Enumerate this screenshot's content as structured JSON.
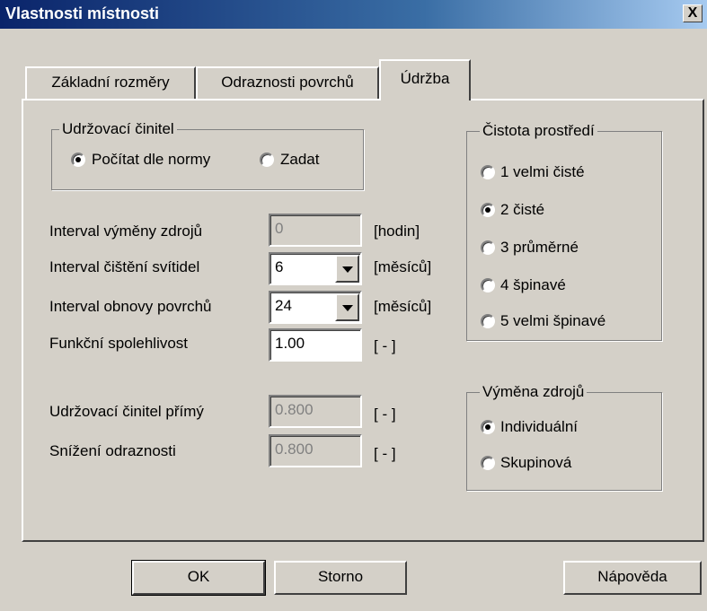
{
  "window": {
    "title": "Vlastnosti místnosti",
    "close_label": "X"
  },
  "tabs": [
    {
      "label": "Základní rozměry"
    },
    {
      "label": "Odraznosti povrchů"
    },
    {
      "label": "Údržba",
      "active": true
    }
  ],
  "udrzovaci_group": {
    "legend": "Udržovací činitel",
    "options": [
      {
        "label": "Počítat dle normy",
        "checked": true
      },
      {
        "label": "Zadat",
        "checked": false
      }
    ]
  },
  "fields": [
    {
      "label": "Interval výměny zdrojů",
      "value": "0",
      "unit": "[hodin]",
      "enabled": false,
      "dropdown": false
    },
    {
      "label": "Interval čištění svítidel",
      "value": "6",
      "unit": "[měsíců]",
      "enabled": true,
      "dropdown": true
    },
    {
      "label": "Interval obnovy povrchů",
      "value": "24",
      "unit": "[měsíců]",
      "enabled": true,
      "dropdown": true
    },
    {
      "label": "Funkční spolehlivost",
      "value": "1.00",
      "unit": "[ - ]",
      "enabled": true,
      "dropdown": false
    },
    {
      "label": "Udržovací činitel přímý",
      "value": "0.800",
      "unit": "[ - ]",
      "enabled": false,
      "dropdown": false
    },
    {
      "label": "Snížení odraznosti",
      "value": "0.800",
      "unit": "[ - ]",
      "enabled": false,
      "dropdown": false
    }
  ],
  "cistota_group": {
    "legend": "Čistota prostředí",
    "options": [
      {
        "label": "1 velmi čisté",
        "checked": false
      },
      {
        "label": "2 čisté",
        "checked": true
      },
      {
        "label": "3 průměrné",
        "checked": false
      },
      {
        "label": "4 špinavé",
        "checked": false
      },
      {
        "label": "5 velmi špinavé",
        "checked": false
      }
    ]
  },
  "vymena_group": {
    "legend": "Výměna zdrojů",
    "options": [
      {
        "label": "Individuální",
        "checked": true
      },
      {
        "label": "Skupinová",
        "checked": false
      }
    ]
  },
  "buttons": {
    "ok": "OK",
    "cancel": "Storno",
    "help": "Nápověda"
  }
}
